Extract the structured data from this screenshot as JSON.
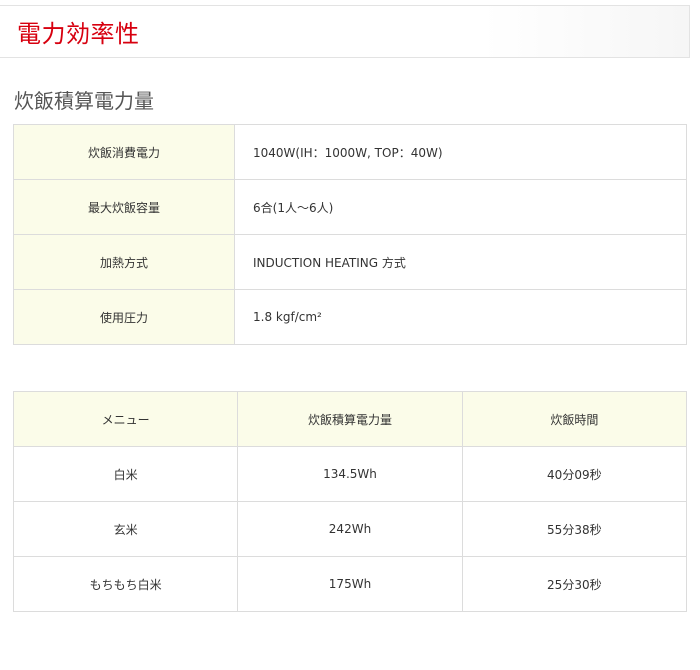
{
  "header": {
    "title": "電力効率性"
  },
  "section": {
    "title": "炊飯積算電力量"
  },
  "spec_table": {
    "rows": [
      {
        "label": "炊飯消費電力",
        "value": "1040W(IH：1000W, TOP：40W)"
      },
      {
        "label": "最大炊飯容量",
        "value": "6合(1人〜6人)"
      },
      {
        "label": "加熱方式",
        "value": "INDUCTION HEATING 方式"
      },
      {
        "label": "使用圧力",
        "value": "1.8 kgf/cm²"
      }
    ]
  },
  "result_table": {
    "headers": [
      "メニュー",
      "炊飯積算電力量",
      "炊飯時間"
    ],
    "rows": [
      [
        "白米",
        "134.5Wh",
        "40分09秒"
      ],
      [
        "玄米",
        "242Wh",
        "55分38秒"
      ],
      [
        "もちもち白米",
        "175Wh",
        "25分30秒"
      ]
    ]
  }
}
